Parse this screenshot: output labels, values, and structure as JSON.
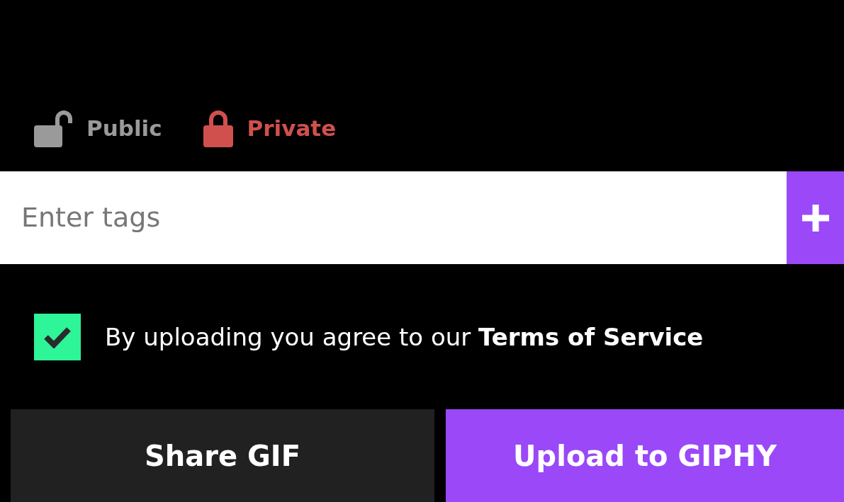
{
  "visibility": [
    {
      "label": "Public",
      "selected": false
    },
    {
      "label": "Private",
      "selected": true
    }
  ],
  "tags": {
    "placeholder": "Enter tags"
  },
  "agreement": {
    "checked": true,
    "text": "By uploading you agree to our",
    "link": "Terms of Service"
  },
  "buttons": [
    {
      "label": "Share GIF",
      "kind": "secondary"
    },
    {
      "label": "Upload to GIPHY",
      "kind": "primary"
    }
  ]
}
